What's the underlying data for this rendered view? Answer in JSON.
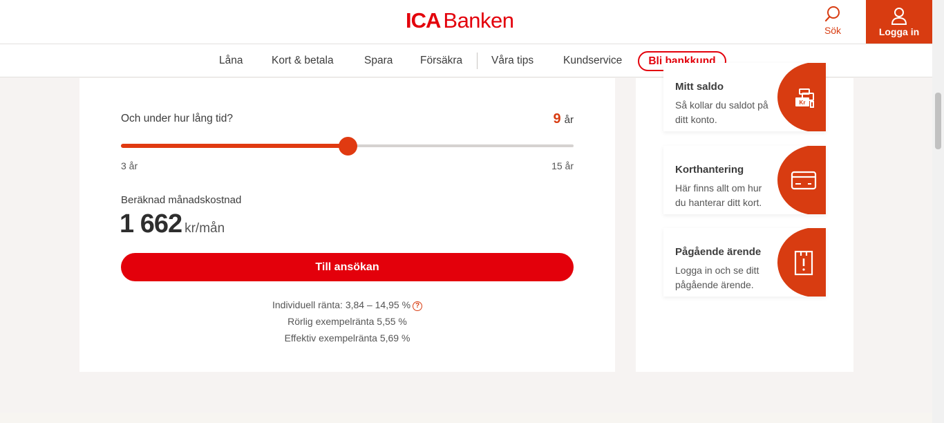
{
  "header": {
    "logo_ica": "ICA",
    "logo_banken": "Banken",
    "search_label": "Sök",
    "login_label": "Logga in"
  },
  "nav": {
    "items": [
      "Låna",
      "Kort & betala",
      "Spara",
      "Försäkra",
      "Våra tips",
      "Kundservice"
    ],
    "cta": "Bli bankkund"
  },
  "calculator": {
    "question": "Och under hur lång tid?",
    "years_value": "9",
    "years_unit": "år",
    "slider_min_label": "3 år",
    "slider_max_label": "15 år",
    "slider_min": 3,
    "slider_max": 15,
    "slider_value": 9,
    "cost_label": "Beräknad månadskostnad",
    "cost_amount": "1 662",
    "cost_unit": "kr/mån",
    "apply_button": "Till ansökan",
    "rate_individual": "Individuell ränta: 3,84 – 14,95 %",
    "rate_variable": "Rörlig exempelränta 5,55 %",
    "rate_effective": "Effektiv exempelränta 5,69 %",
    "help_icon": "?"
  },
  "shortcuts": [
    {
      "title": "Mitt saldo",
      "text": "Så kollar du saldot på ditt konto.",
      "icon": "coins-icon",
      "icon_label": "Kr"
    },
    {
      "title": "Korthantering",
      "text": "Här finns allt om hur du hanterar ditt kort.",
      "icon": "card-icon"
    },
    {
      "title": "Pågående ärende",
      "text": "Logga in och se ditt pågående ärende.",
      "icon": "alert-note-icon"
    }
  ],
  "colors": {
    "brand_red": "#e3000b",
    "accent_orange": "#d83c11",
    "background": "#f6f3f2"
  }
}
